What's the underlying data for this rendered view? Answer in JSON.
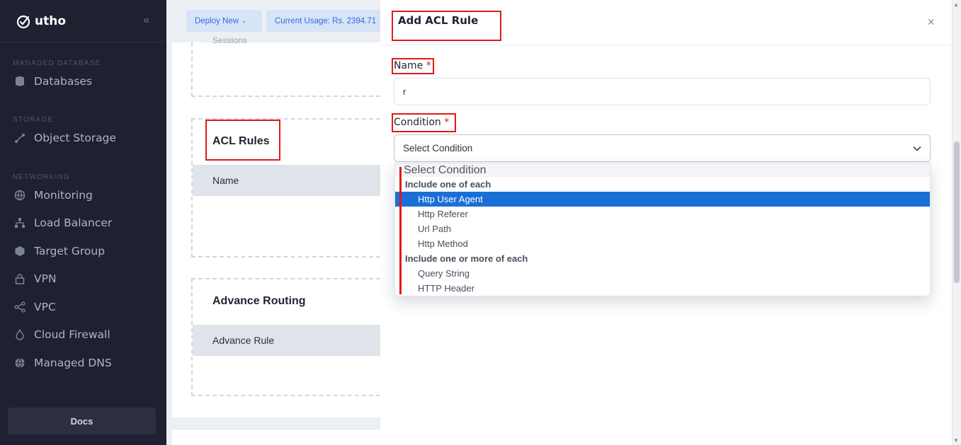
{
  "sidebar": {
    "brand": "utho",
    "sections": [
      {
        "title": "MANAGED DATABASE",
        "items": [
          {
            "label": "Databases",
            "icon": "database-icon"
          }
        ]
      },
      {
        "title": "STORAGE",
        "items": [
          {
            "label": "Object Storage",
            "icon": "object-storage-icon"
          }
        ]
      },
      {
        "title": "NETWORKING",
        "items": [
          {
            "label": "Monitoring",
            "icon": "globe-icon"
          },
          {
            "label": "Load Balancer",
            "icon": "network-icon"
          },
          {
            "label": "Target Group",
            "icon": "target-icon"
          },
          {
            "label": "VPN",
            "icon": "lock-icon"
          },
          {
            "label": "VPC",
            "icon": "share-icon"
          },
          {
            "label": "Cloud Firewall",
            "icon": "firewall-icon"
          },
          {
            "label": "Managed DNS",
            "icon": "dns-globe-icon"
          }
        ]
      }
    ],
    "docs_label": "Docs"
  },
  "topbar": {
    "deploy_label": "Deploy New",
    "usage_label": "Current Usage: Rs. 2394.71"
  },
  "background": {
    "sessions_text": "Sessions",
    "acl_title": "ACL Rules",
    "acl_col": "Name",
    "adv_title": "Advance Routing",
    "adv_col": "Advance Rule"
  },
  "modal": {
    "title": "Add ACL Rule",
    "name_label": "Name",
    "name_value": "r",
    "required_mark": "*",
    "condition_label": "Condition",
    "condition_placeholder": "Select Condition",
    "dropdown": {
      "placeholder_option": "Select Condition",
      "groups": [
        {
          "label": "Include one of each",
          "options": [
            "Http User Agent",
            "Http Referer",
            "Url Path",
            "Http Method"
          ]
        },
        {
          "label": "Include one or more of each",
          "options": [
            "Query String",
            "HTTP Header"
          ]
        }
      ],
      "selected": "Http User Agent"
    }
  },
  "colors": {
    "sidebar_bg": "#1e2130",
    "accent": "#1a6fd6",
    "annotation_red": "#e01a1a"
  }
}
